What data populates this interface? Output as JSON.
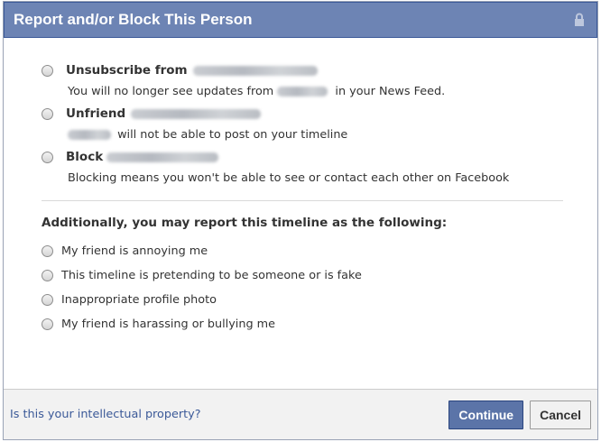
{
  "dialog": {
    "title": "Report and/or Block This Person",
    "lock_icon": "lock-icon"
  },
  "options": [
    {
      "label": "Unsubscribe from",
      "description_before": "You will no longer see updates from",
      "description_after": "in your News Feed."
    },
    {
      "label": "Unfriend",
      "description_before": "",
      "description_after": "will not be able to post on your timeline"
    },
    {
      "label": "Block",
      "description_before": "Blocking means you won't be able to see or contact each other on Facebook",
      "description_after": ""
    }
  ],
  "report": {
    "heading": "Additionally, you may report this timeline as the following:",
    "items": [
      "My friend is annoying me",
      "This timeline is pretending to be someone or is fake",
      "Inappropriate profile photo",
      "My friend is harassing or bullying me"
    ]
  },
  "footer": {
    "ip_link": "Is this your intellectual property?",
    "continue_label": "Continue",
    "cancel_label": "Cancel"
  },
  "colors": {
    "titlebar": "#6d84b4",
    "link": "#3b5998",
    "primary_button": "#5b74a8"
  }
}
